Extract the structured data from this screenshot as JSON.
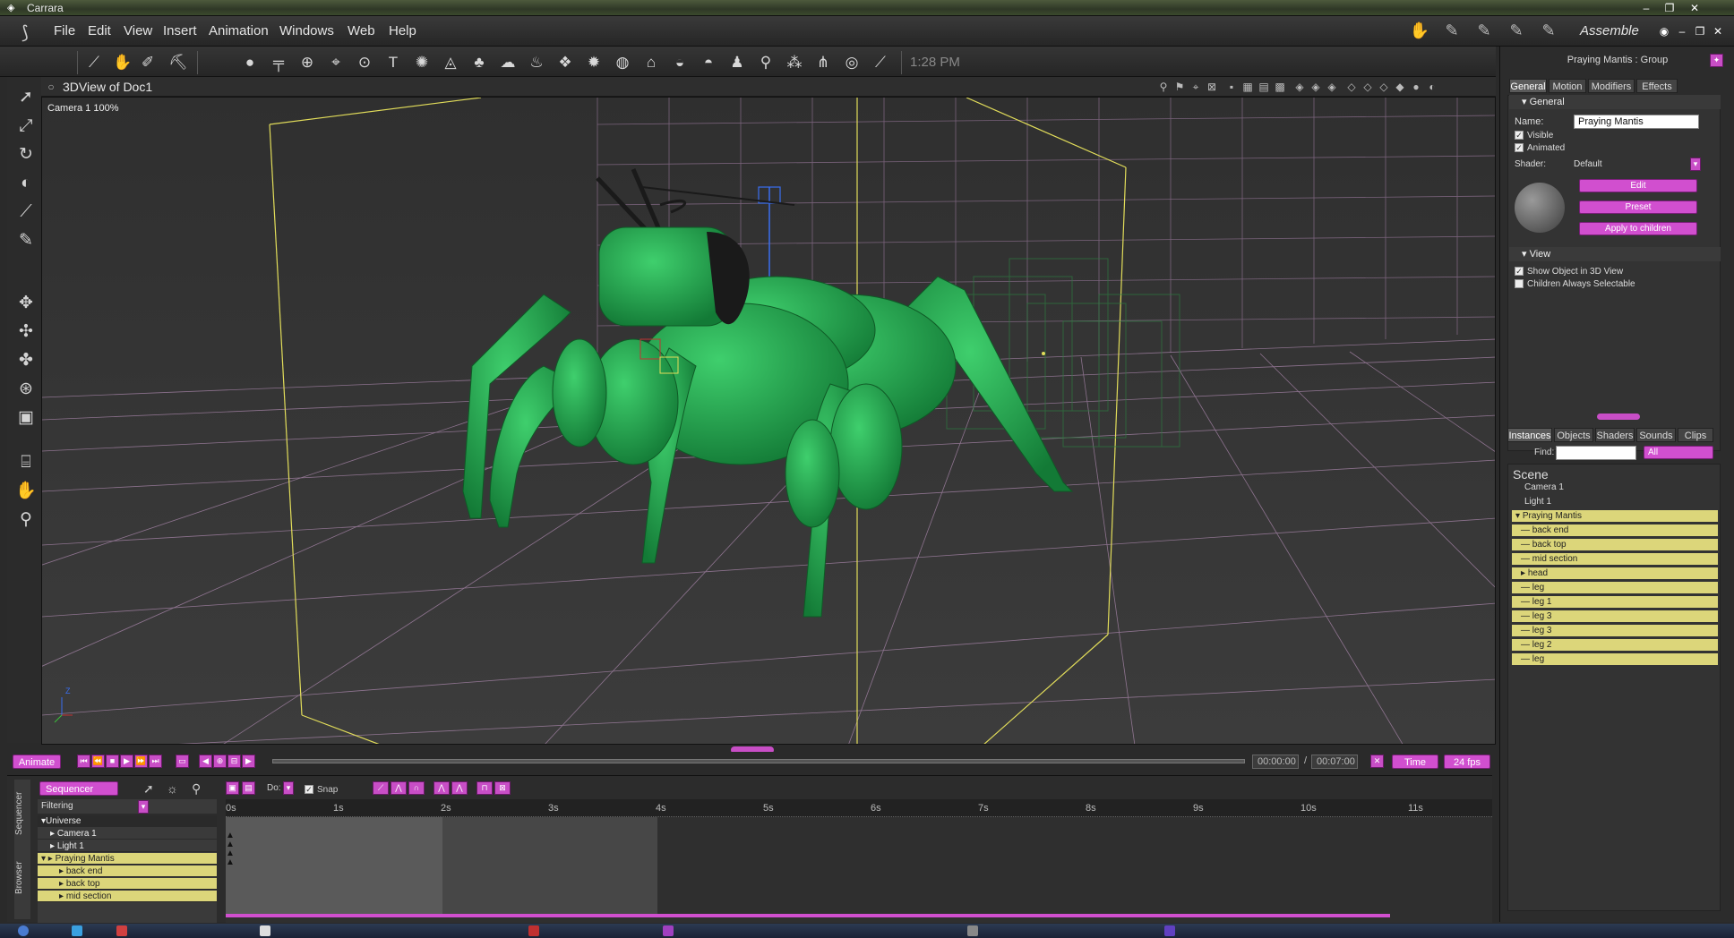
{
  "window": {
    "title": "Carrara"
  },
  "menu": [
    "File",
    "Edit",
    "View",
    "Insert",
    "Animation",
    "Windows",
    "Web",
    "Help"
  ],
  "room": {
    "label": "Assemble"
  },
  "toolbar": {
    "time": "1:28 PM"
  },
  "view": {
    "title": "3DView of Doc1",
    "camera_label": "Camera 1 100%"
  },
  "transport": {
    "animate_label": "Animate",
    "time_current": "00:00:00",
    "time_separator": "/",
    "time_end": "00:07:00",
    "time_mode": "Time",
    "fps": "24 fps"
  },
  "sequencer": {
    "mode": "Sequencer",
    "doc_label": "Do:",
    "snap_label": "Snap",
    "filtering_label": "Filtering",
    "tabs": [
      "Sequencer",
      "Browser"
    ],
    "ticks": [
      "0s",
      "1s",
      "2s",
      "3s",
      "4s",
      "5s",
      "6s",
      "7s",
      "8s",
      "9s",
      "10s",
      "11s"
    ],
    "tracks": [
      {
        "name": "Universe",
        "selected": false
      },
      {
        "name": "Camera 1",
        "selected": false
      },
      {
        "name": "Light 1",
        "selected": false
      },
      {
        "name": "Praying Mantis",
        "selected": true
      },
      {
        "name": "back end",
        "selected": true
      },
      {
        "name": "back top",
        "selected": true
      },
      {
        "name": "mid section",
        "selected": true
      }
    ]
  },
  "properties": {
    "header": "Praying Mantis : Group",
    "tabs": [
      "General",
      "Motion",
      "Modifiers",
      "Effects"
    ],
    "general_section": "General",
    "name_label": "Name:",
    "name_value": "Praying Mantis",
    "visible_label": "Visible",
    "animated_label": "Animated",
    "shader_label": "Shader:",
    "shader_value": "Default",
    "edit_button": "Edit",
    "preset_button": "Preset",
    "apply_button": "Apply to children",
    "view_section": "View",
    "show_object_label": "Show Object in 3D View",
    "children_selectable_label": "Children Always Selectable"
  },
  "instances": {
    "tabs": [
      "Instances",
      "Objects",
      "Shaders",
      "Sounds",
      "Clips"
    ],
    "find_label": "Find:",
    "filter_value": "All",
    "scene_label": "Scene",
    "items": [
      {
        "name": "Camera 1",
        "selected": false,
        "indent": 0
      },
      {
        "name": "Light 1",
        "selected": false,
        "indent": 0
      },
      {
        "name": "Praying Mantis",
        "selected": true,
        "indent": 0
      },
      {
        "name": "back end",
        "selected": true,
        "indent": 1
      },
      {
        "name": "back top",
        "selected": true,
        "indent": 1
      },
      {
        "name": "mid section",
        "selected": true,
        "indent": 1
      },
      {
        "name": "head",
        "selected": true,
        "indent": 1
      },
      {
        "name": "leg",
        "selected": true,
        "indent": 1
      },
      {
        "name": "leg 1",
        "selected": true,
        "indent": 1
      },
      {
        "name": "leg 3",
        "selected": true,
        "indent": 1
      },
      {
        "name": "leg 3",
        "selected": true,
        "indent": 1
      },
      {
        "name": "leg 2",
        "selected": true,
        "indent": 1
      },
      {
        "name": "leg",
        "selected": true,
        "indent": 1
      }
    ]
  },
  "colors": {
    "accent": "#d14fcf",
    "selection": "#dcd67a",
    "model": "#1e9b4a"
  }
}
